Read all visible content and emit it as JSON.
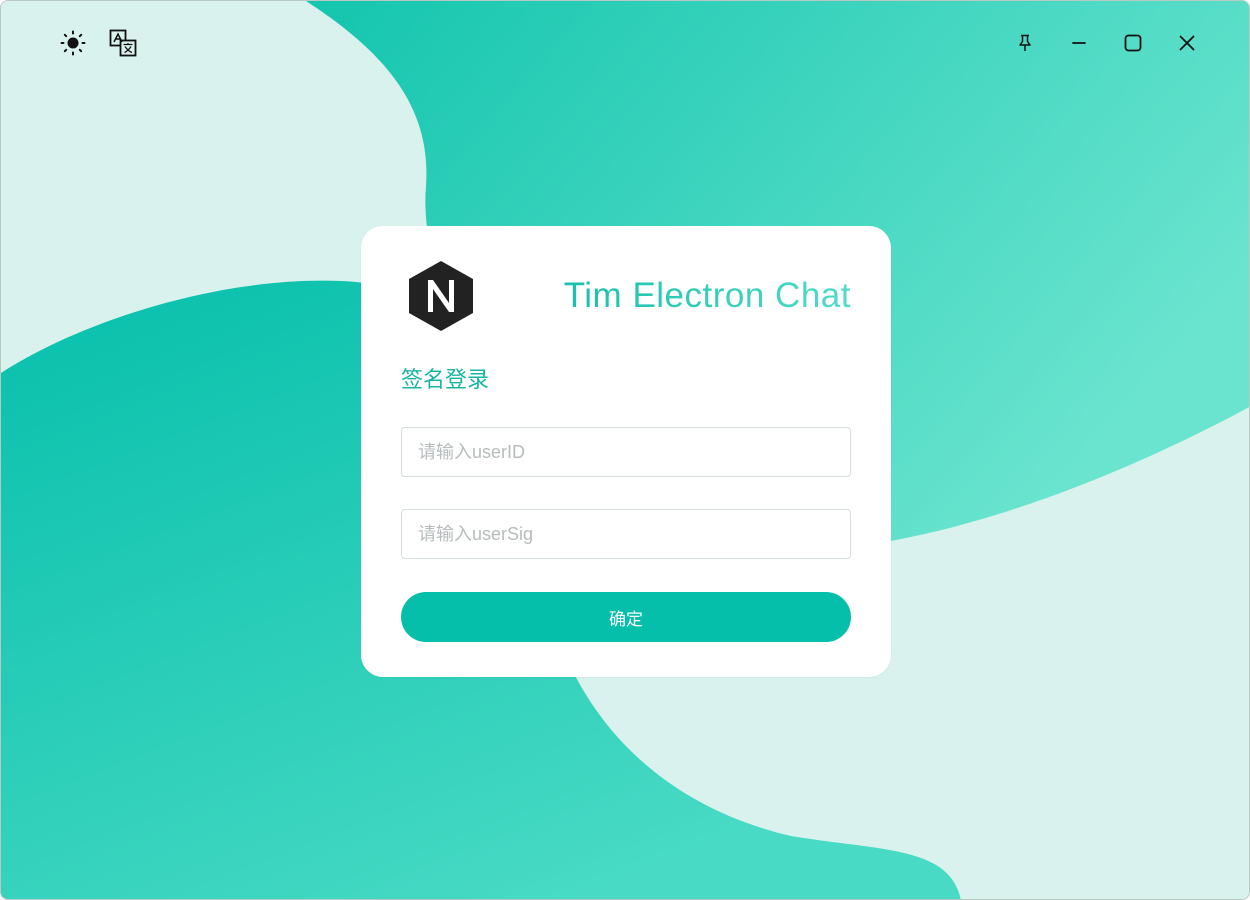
{
  "app": {
    "title": "Tim Electron Chat"
  },
  "toolbar_left": {
    "theme_icon": "sun-icon",
    "language_icon": "translate-icon"
  },
  "window_controls": {
    "pin_icon": "pin-icon",
    "minimize_icon": "minimize-icon",
    "maximize_icon": "maximize-icon",
    "close_icon": "close-icon"
  },
  "login": {
    "heading": "签名登录",
    "user_id": {
      "value": "",
      "placeholder": "请输入userID"
    },
    "user_sig": {
      "value": "",
      "placeholder": "请输入userSig"
    },
    "confirm_label": "确定"
  },
  "logo": {
    "letter": "N",
    "shape": "hexagon"
  },
  "colors": {
    "accent": "#06bfab",
    "title_gradient_start": "#19c0ab",
    "title_gradient_end": "#52dbc7",
    "background_light": "#d9f2ed",
    "background_teal": "#0ec4ad",
    "logo_dark": "#222222"
  }
}
